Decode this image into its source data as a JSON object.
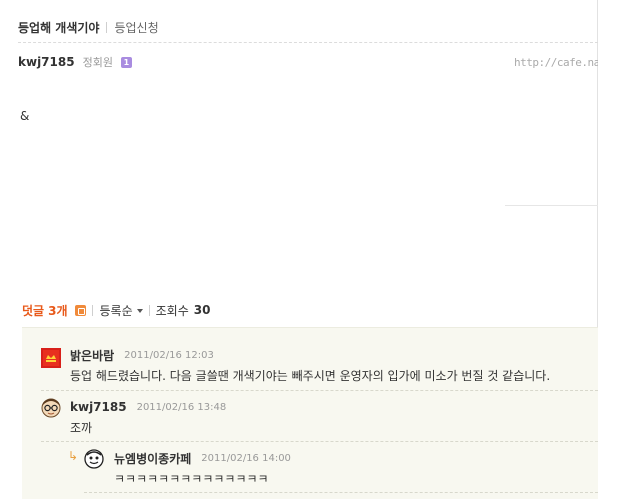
{
  "post": {
    "title": "등업해 개색기야",
    "category": "등업신청",
    "author": "kwj7185",
    "member_level": "정회원",
    "level_badge": "1",
    "url": "http://cafe.naver",
    "body": "&"
  },
  "comment_bar": {
    "label": "덧글",
    "count": "3개",
    "sort_label": "등록순",
    "views_label": "조회수",
    "views": "30"
  },
  "comments": [
    {
      "author": "밝은바람",
      "date": "2011/02/16 12:03",
      "text": "등업 해드렸습니다. 다음 글쓸땐 개색기야는 빼주시면 운영자의 입가에 미소가 번질 것 같습니다.",
      "avatar": "manager-crown-icon"
    },
    {
      "author": "kwj7185",
      "date": "2011/02/16 13:48",
      "text": "조까",
      "avatar": "glasses-face-icon"
    },
    {
      "author": "뉴엠병이종카페",
      "date": "2011/02/16 14:00",
      "text": "ㅋㅋㅋㅋㅋㅋㅋㅋㅋㅋㅋㅋㅋㅋ",
      "avatar": "cartoon-face-icon",
      "is_reply": true
    }
  ],
  "colors": {
    "accent": "#e8591a",
    "comment_bg": "#f8f8f0",
    "level_badge": "#a98ce0"
  }
}
